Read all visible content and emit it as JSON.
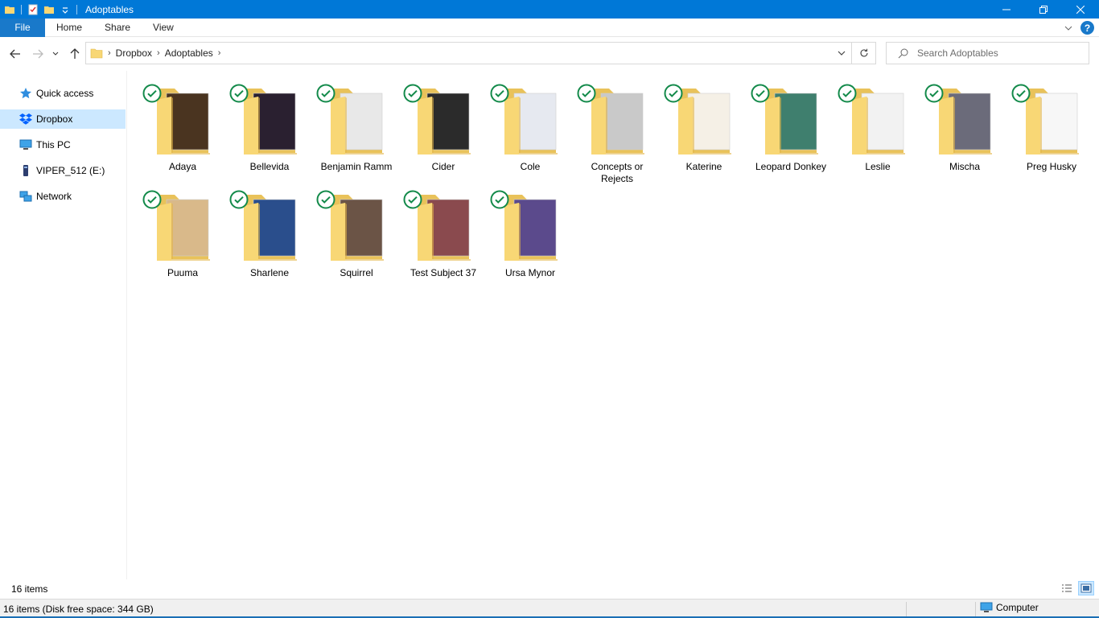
{
  "window": {
    "title": "Adoptables",
    "accent": "#0078d7"
  },
  "ribbon": {
    "tabs": [
      "File",
      "Home",
      "Share",
      "View"
    ]
  },
  "address": {
    "crumbs": [
      "Dropbox",
      "Adoptables"
    ]
  },
  "search": {
    "placeholder": "Search Adoptables"
  },
  "navpane": {
    "items": [
      "Quick access",
      "Dropbox",
      "This PC",
      "VIPER_512 (E:)",
      "Network"
    ],
    "selected": "Dropbox"
  },
  "folders": [
    {
      "name": "Adaya",
      "thumb": "#4a3420"
    },
    {
      "name": "Bellevida",
      "thumb": "#2a2030"
    },
    {
      "name": "Benjamin Ramm",
      "thumb": "#e8e8e8"
    },
    {
      "name": "Cider",
      "thumb": "#2b2b2b"
    },
    {
      "name": "Cole",
      "thumb": "#e6e9f0"
    },
    {
      "name": "Concepts or Rejects",
      "thumb": "#c9c9c9"
    },
    {
      "name": "Katerine",
      "thumb": "#f5f0e6"
    },
    {
      "name": "Leopard Donkey",
      "thumb": "#3f7f6e"
    },
    {
      "name": "Leslie",
      "thumb": "#f2f2f2"
    },
    {
      "name": "Mischa",
      "thumb": "#6b6b7a"
    },
    {
      "name": "Preg Husky",
      "thumb": "#f7f7f7"
    },
    {
      "name": "Puuma",
      "thumb": "#d9b98a"
    },
    {
      "name": "Sharlene",
      "thumb": "#2a4e8c"
    },
    {
      "name": "Squirrel",
      "thumb": "#6b5446"
    },
    {
      "name": "Test Subject 37",
      "thumb": "#8a4a4e"
    },
    {
      "name": "Ursa Mynor",
      "thumb": "#5b4a8c"
    }
  ],
  "status": {
    "count": "16 items",
    "bar": "16 items (Disk free space: 344 GB)",
    "location": "Computer"
  },
  "icons": {
    "sync": "check-circle-icon",
    "folder": "folder-icon"
  }
}
